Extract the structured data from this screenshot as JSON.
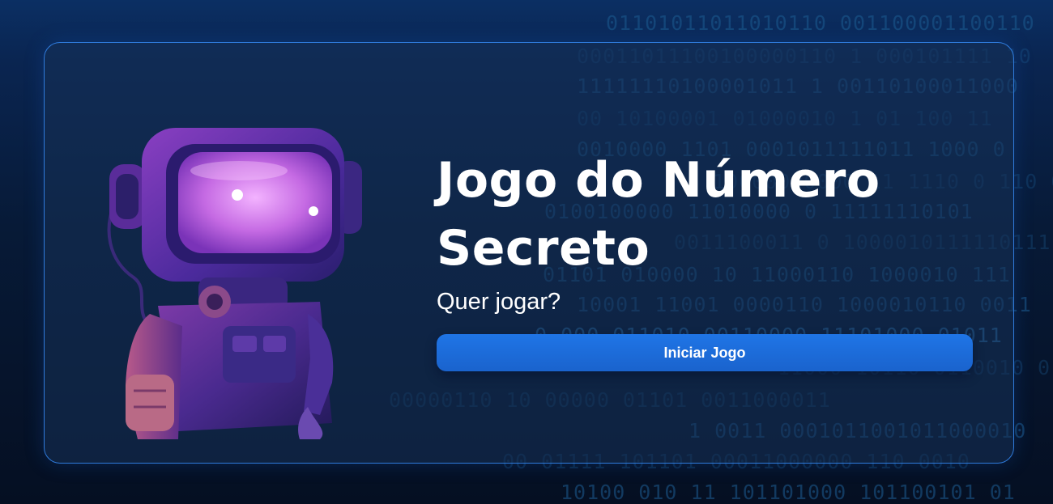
{
  "game": {
    "title_line1": "Jogo do Número",
    "title_line2": "Secreto",
    "subtitle": "Quer jogar?",
    "start_button_label": "Iniciar Jogo"
  },
  "background": {
    "binary_lines": [
      "01101011011010110   001100001100110",
      "00011011100100000110 1 000101111  10",
      "11111110100001011 1 00110100011000",
      "00 10100001 01000010  1 01 100 11",
      "0010000 1101 0001011111011 1000 0",
      "10000000000 11 1110 0 110 0 0111100",
      "0100100000 11010000  0  11111110101",
      "0011100011 0  1000010111110111",
      "01101 010000 10 11000110 1000010 111",
      "10001 11001  0000110 1000010110 0011",
      "0 000  011010 00110000 11101000 01011",
      "11000   10110 0110010 0111 11 10 00",
      "00000110   10    00000 01101   0011000011",
      "1  0011 0001011001011000010",
      "00 01111   101101 00011000000 110 0010",
      "10100 010 11 101101000 101100101 01"
    ]
  },
  "colors": {
    "accent": "#1f75e6",
    "card_border": "#2f7bdc",
    "binary_text": "#1d5d92"
  }
}
